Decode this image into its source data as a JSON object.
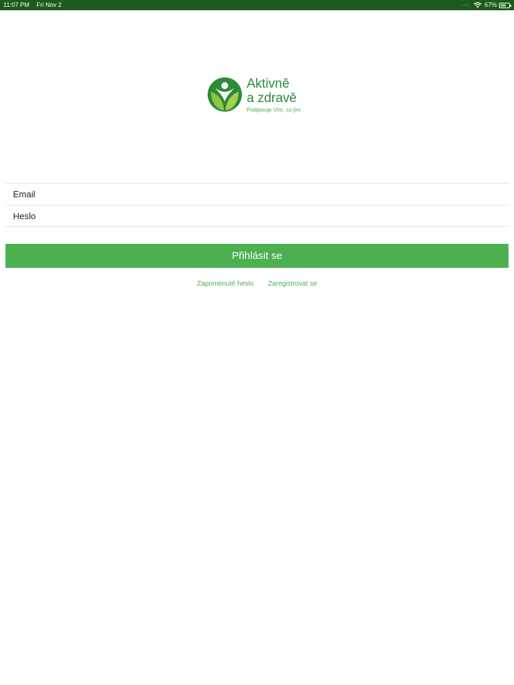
{
  "status_bar": {
    "time": "11:07 PM",
    "date": "Fri Nov 2",
    "signal": ".....",
    "battery_percent_text": "67%",
    "battery_level": 0.67,
    "icons": [
      "wifi-icon",
      "battery-charging-icon"
    ]
  },
  "logo": {
    "line1": "Aktivně",
    "line2": "a zdravě",
    "tagline": "Podporuje Vím, co jím",
    "icon": "leaf-person-icon",
    "colors": {
      "dark_green": "#2a8a3a",
      "light_green": "#8cc63f"
    }
  },
  "form": {
    "email_placeholder": "Email",
    "email_value": "",
    "password_placeholder": "Heslo",
    "password_value": ""
  },
  "login_button": {
    "label": "Přihlásit se",
    "color": "#4caf50"
  },
  "links": {
    "forgot_password": "Zapomenuté heslo",
    "register": "Zaregistrovat se"
  }
}
